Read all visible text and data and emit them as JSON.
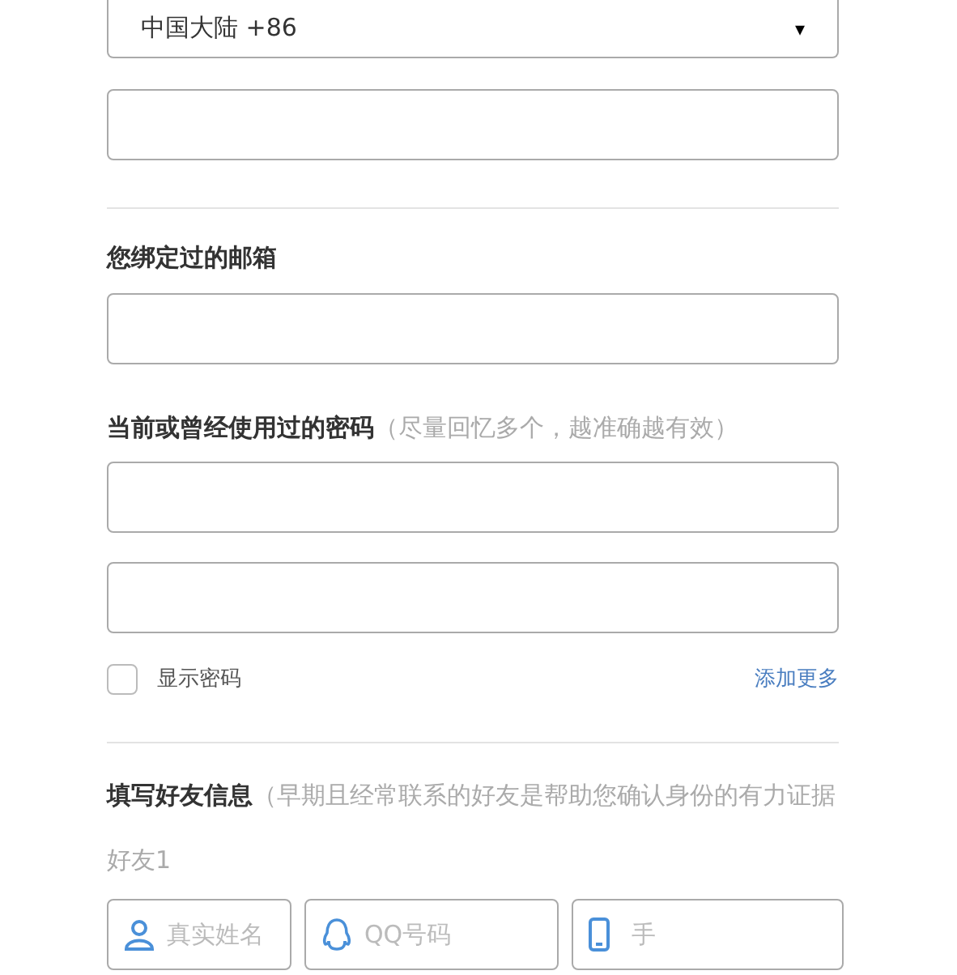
{
  "region_select": {
    "value": "中国大陆 +86",
    "caret": "▾"
  },
  "email": {
    "label": "您绑定过的邮箱"
  },
  "passwords": {
    "label": "当前或曾经使用过的密码",
    "hint": "（尽量回忆多个，越准确越有效",
    "hint_end": "）"
  },
  "show_password": {
    "label": "显示密码",
    "checked": false
  },
  "add_more": "添加更多",
  "friends": {
    "label": "填写好友信息",
    "hint": "（早期且经常联系的好友是帮助您确认身份的有力证据"
  },
  "friend_1": {
    "label": "好友1",
    "fields": [
      {
        "kind": "name",
        "placeholder": "真实姓名"
      },
      {
        "kind": "qq",
        "placeholder": "QQ号码"
      },
      {
        "kind": "phone",
        "placeholder": "手"
      }
    ]
  }
}
